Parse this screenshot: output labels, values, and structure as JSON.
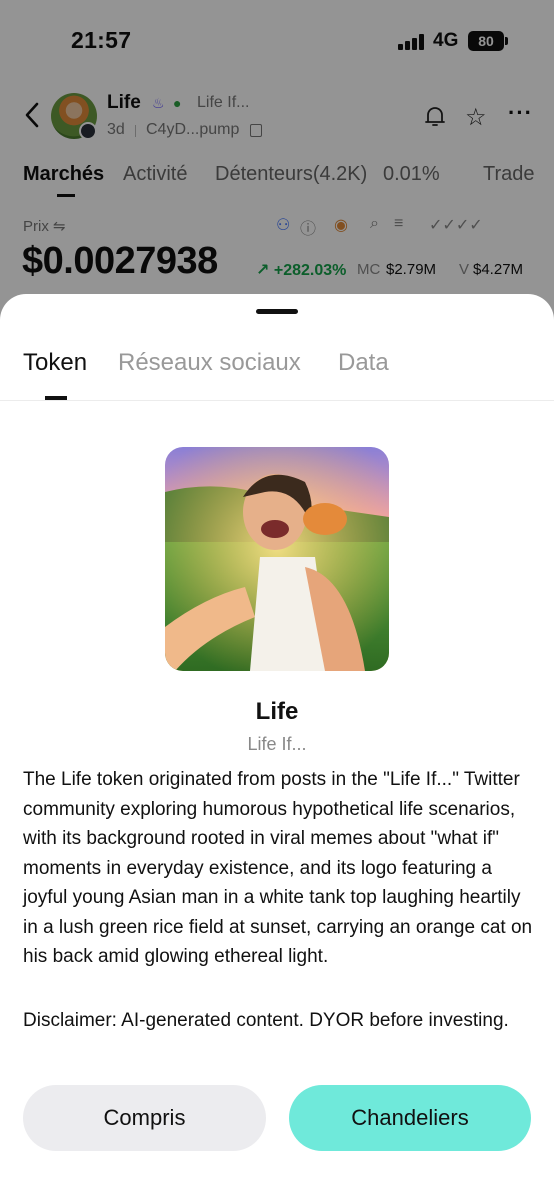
{
  "status_bar": {
    "time": "21:57",
    "network": "4G",
    "battery": "80"
  },
  "header": {
    "token_name": "Life",
    "token_subtitle": "Life If...",
    "age": "3d",
    "address": "C4yD...pump"
  },
  "tabs": [
    {
      "label": "Marchés"
    },
    {
      "label": "Activité"
    },
    {
      "label": "Détenteurs(4.2K)"
    },
    {
      "label": "0.01%"
    },
    {
      "label": "Trade"
    }
  ],
  "market": {
    "price_label": "Prix ⇋",
    "price": "$0.0027938",
    "change": "↗ +282.03%",
    "mc_label": "MC",
    "mc_value": "$2.79M",
    "v_label": "V",
    "v_value": "$4.27M"
  },
  "sheet": {
    "tabs": [
      {
        "label": "Token"
      },
      {
        "label": "Réseaux sociaux"
      },
      {
        "label": "Data"
      }
    ],
    "title": "Life",
    "subtitle": "Life If...",
    "description": "The Life token originated from posts in the \"Life If...\" Twitter community exploring humorous hypothetical life scenarios, with its background rooted in viral memes about \"what if\" moments in everyday existence, and its logo featuring a joyful young Asian man in a white tank top laughing heartily in a lush green rice field at sunset, carrying an orange cat on his back amid glowing ethereal light.",
    "disclaimer": "Disclaimer: AI-generated content. DYOR before investing.",
    "buttons": {
      "compris": "Compris",
      "chandeliers": "Chandeliers"
    }
  },
  "colors": {
    "accent": "#6fe9da",
    "positive": "#16a34a"
  }
}
